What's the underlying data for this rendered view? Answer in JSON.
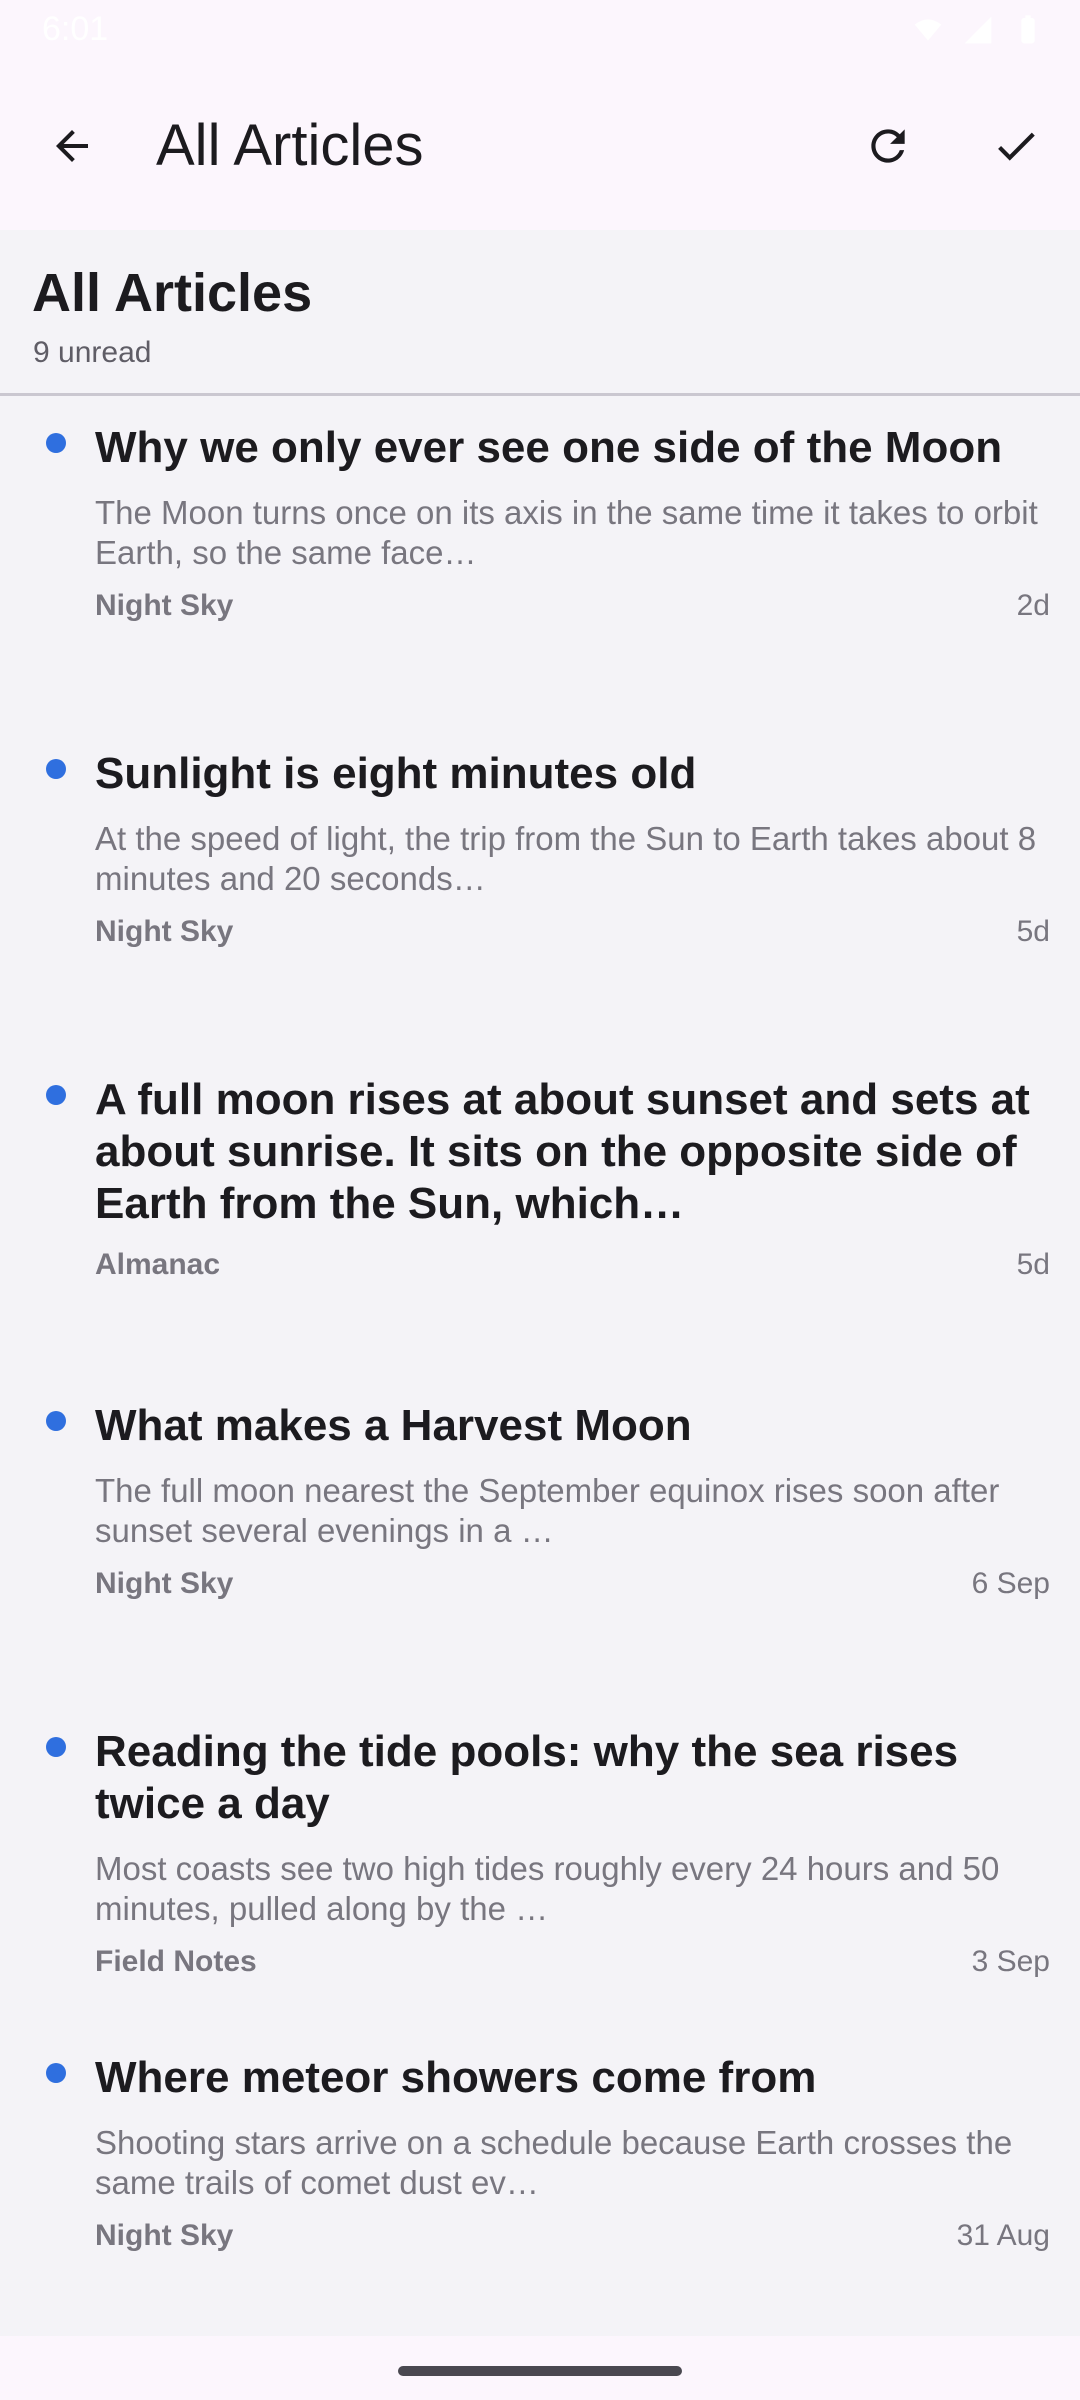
{
  "status_bar": {
    "time": "6:01",
    "icons": [
      "screenshot-icon",
      "wifi-icon",
      "signal-icon",
      "battery-icon"
    ]
  },
  "app_bar": {
    "title": "All Articles",
    "icons": [
      "back-arrow-icon",
      "refresh-icon",
      "check-icon"
    ]
  },
  "list_header": {
    "title": "All Articles",
    "unread": "9 unread"
  },
  "articles": [
    {
      "title": "Why we only ever see one side of the Moon",
      "snippet": "The Moon turns once on its axis in the same time it takes to orbit Earth, so the same face…",
      "source": "Night Sky",
      "age": "2d",
      "unread": true
    },
    {
      "title": "Sunlight is eight minutes old",
      "snippet": "At the speed of light, the trip from the Sun to Earth takes about 8 minutes and 20 seconds…",
      "source": "Night Sky",
      "age": "5d",
      "unread": true
    },
    {
      "title": "A full moon rises at about sunset and sets at about sunrise. It sits on the opposite side of Earth from the Sun, which…",
      "snippet": "",
      "source": "Almanac",
      "age": "5d",
      "unread": true
    },
    {
      "title": "What makes a Harvest Moon",
      "snippet": "The full moon nearest the September equinox rises soon after sunset several evenings in a …",
      "source": "Night Sky",
      "age": "6 Sep",
      "unread": true
    },
    {
      "title": "Reading the tide pools: why the sea rises twice a day",
      "snippet": "Most coasts see two high tides roughly every 24 hours and 50 minutes, pulled along by the …",
      "source": "Field Notes",
      "age": "3 Sep",
      "unread": true
    },
    {
      "title": "Where meteor showers come from",
      "snippet": "Shooting stars arrive on a schedule because Earth crosses the same trails of comet dust ev…",
      "source": "Night Sky",
      "age": "31 Aug",
      "unread": true
    }
  ],
  "colors": {
    "app_bar_bg": "#fcf6fd",
    "list_bg": "#f4f3f7",
    "unread_dot": "#2f6fdf",
    "divider": "#cac7d0"
  }
}
